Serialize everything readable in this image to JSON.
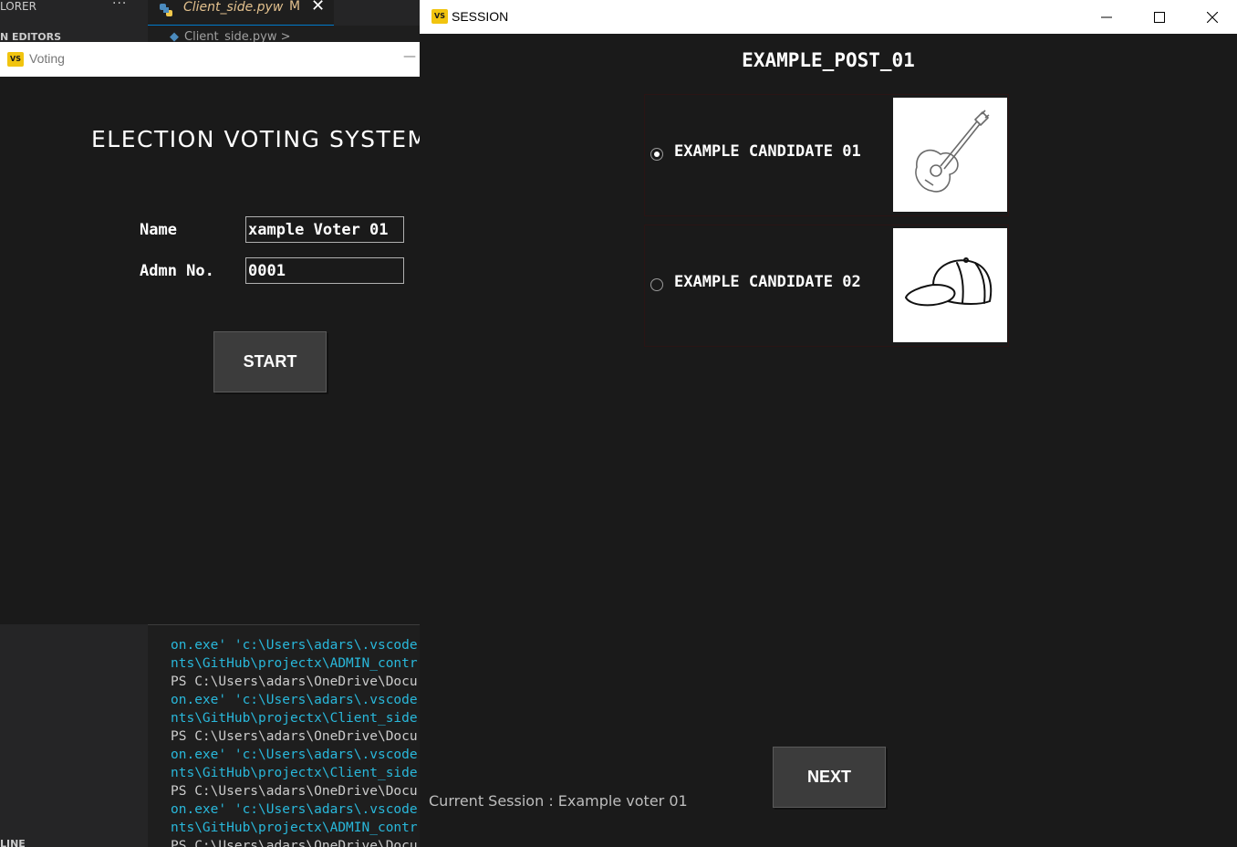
{
  "vscode": {
    "explorer_title": "LORER",
    "explorer_more": "···",
    "open_editors_label": "N EDITORS",
    "bottom_section_label": "LINE",
    "tab": {
      "filename": "Client_side.pyw",
      "modified_badge": "M",
      "close_glyph": "✕"
    },
    "breadcrumb": "Client_side.pyw >",
    "terminal_lines": [
      {
        "text": "on.exe' 'c:\\Users\\adars\\.vscode",
        "color": "cyan"
      },
      {
        "text": "nts\\GitHub\\projectx\\ADMIN_contr",
        "color": "cyan"
      },
      {
        "text": "PS C:\\Users\\adars\\OneDrive\\Docu",
        "color": "white"
      },
      {
        "text": "on.exe' 'c:\\Users\\adars\\.vscode",
        "color": "cyan"
      },
      {
        "text": "nts\\GitHub\\projectx\\Client_side",
        "color": "cyan"
      },
      {
        "text": "PS C:\\Users\\adars\\OneDrive\\Docu",
        "color": "white"
      },
      {
        "text": "on.exe' 'c:\\Users\\adars\\.vscode",
        "color": "cyan"
      },
      {
        "text": "nts\\GitHub\\projectx\\Client_side",
        "color": "cyan"
      },
      {
        "text": "PS C:\\Users\\adars\\OneDrive\\Docu",
        "color": "white"
      },
      {
        "text": "on.exe' 'c:\\Users\\adars\\.vscode",
        "color": "cyan"
      },
      {
        "text": "nts\\GitHub\\projectx\\ADMIN_contr",
        "color": "cyan"
      },
      {
        "text": "PS C:\\Users\\adars\\OneDrive\\Docu",
        "color": "white"
      }
    ]
  },
  "voting_window": {
    "title": "Voting",
    "minimize_glyph": "—",
    "heading": "ELECTION VOTING SYSTEM",
    "name_label": "Name",
    "name_value": "xample Voter 01",
    "admn_label": "Admn No.",
    "admn_value": "0001",
    "start_label": "START"
  },
  "session_window": {
    "title": "SESSION",
    "post_title": "EXAMPLE_POST_01",
    "candidates": [
      {
        "name": "EXAMPLE CANDIDATE 01",
        "selected": true,
        "image_icon": "guitar-icon"
      },
      {
        "name": "EXAMPLE CANDIDATE 02",
        "selected": false,
        "image_icon": "cap-icon"
      }
    ],
    "next_label": "NEXT",
    "status": "Current Session : Example voter 01"
  },
  "colors": {
    "app_background": "#1a1a1a",
    "button_background": "#3c3c3c",
    "terminal_cyan": "#29b8db",
    "terminal_white": "#cccccc",
    "tab_text": "#e2c08d",
    "app_icon": "#f1c40f"
  }
}
